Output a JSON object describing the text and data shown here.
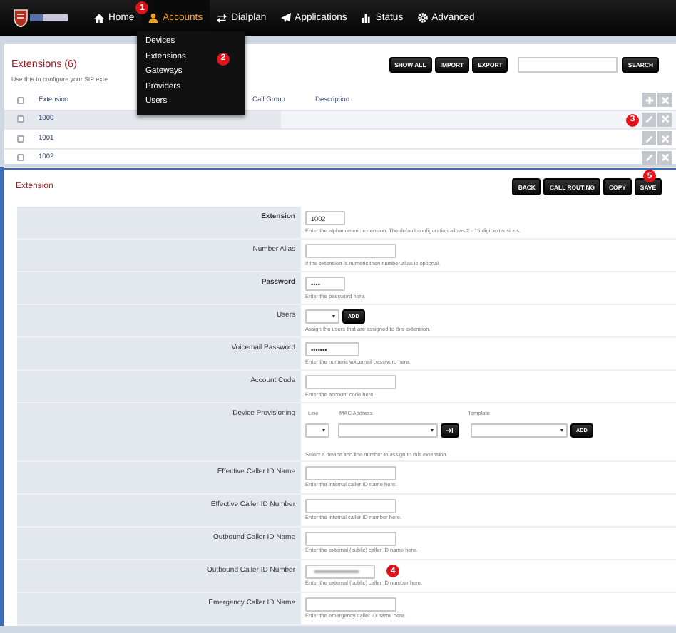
{
  "nav": {
    "items": [
      {
        "label": "Home",
        "selected": false
      },
      {
        "label": "Accounts",
        "selected": true,
        "badge": "1"
      },
      {
        "label": "Dialplan",
        "selected": false
      },
      {
        "label": "Applications",
        "selected": false
      },
      {
        "label": "Status",
        "selected": false
      },
      {
        "label": "Advanced",
        "selected": false
      }
    ]
  },
  "accounts_menu": {
    "items": [
      {
        "label": "Devices"
      },
      {
        "label": "Extensions",
        "badge": "2"
      },
      {
        "label": "Gateways"
      },
      {
        "label": "Providers"
      },
      {
        "label": "Users"
      }
    ]
  },
  "extensions_list": {
    "title": "Extensions (6)",
    "description": "Use this to configure your SIP exte",
    "buttons": [
      "SHOW ALL",
      "IMPORT",
      "EXPORT"
    ],
    "search_button": "SEARCH",
    "all_checked": false,
    "columns": [
      "Extension",
      "Call Group",
      "Description"
    ],
    "rows": [
      {
        "extension": "1000",
        "checked": false,
        "selected": true,
        "badge": "3"
      },
      {
        "extension": "1001",
        "checked": false,
        "selected": false
      },
      {
        "extension": "1002",
        "checked": false,
        "selected": false
      }
    ]
  },
  "extension_form": {
    "title": "Extension",
    "buttons": [
      {
        "label": "BACK"
      },
      {
        "label": "CALL ROUTING"
      },
      {
        "label": "COPY"
      },
      {
        "label": "SAVE",
        "badge": "5"
      }
    ],
    "fields": [
      {
        "kind": "text",
        "label": "Extension",
        "required": true,
        "redacted": false,
        "value": "1002",
        "hint": "Enter the alphanumeric extension. The default configuration allows 2 - 15 digit extensions."
      },
      {
        "kind": "text",
        "label": "Number Alias",
        "required": false,
        "redacted": false,
        "hint": "If the extension is numeric then number alias is optional."
      },
      {
        "kind": "text",
        "label": "Password",
        "required": true,
        "redacted": false,
        "value": "••••",
        "hint": "Enter the password here."
      },
      {
        "kind": "users",
        "label": "Users",
        "required": false,
        "button": "ADD",
        "hint": "Assign the users that are assigned to this extension."
      },
      {
        "kind": "text",
        "label": "Voicemail Password",
        "required": false,
        "redacted": false,
        "value": "•••••••",
        "hint": "Enter the numeric voicemail password here."
      },
      {
        "kind": "text",
        "label": "Account Code",
        "required": false,
        "redacted": false,
        "hint": "Enter the account code here."
      },
      {
        "kind": "provisioning",
        "label": "Device Provisioning",
        "required": false,
        "columns": [
          "Line",
          "MAC Address",
          "Template"
        ],
        "button": "ADD",
        "hint": "Select a device and line number to assign to this extension."
      },
      {
        "kind": "text",
        "label": "Effective Caller ID Name",
        "required": false,
        "redacted": false,
        "hint": "Enter the internal caller ID name here."
      },
      {
        "kind": "text",
        "label": "Effective Caller ID Number",
        "required": false,
        "redacted": false,
        "hint": "Enter the internal caller ID number here."
      },
      {
        "kind": "text",
        "label": "Outbound Caller ID Name",
        "required": false,
        "redacted": false,
        "hint": "Enter the external (public) caller ID name here."
      },
      {
        "kind": "text",
        "label": "Outbound Caller ID Number",
        "required": false,
        "redacted": true,
        "badge": "4",
        "hint": "Enter the external (public) caller ID number here."
      },
      {
        "kind": "text",
        "label": "Emergency Caller ID Name",
        "required": false,
        "redacted": false,
        "hint": "Enter the emergency caller ID name here."
      }
    ]
  }
}
